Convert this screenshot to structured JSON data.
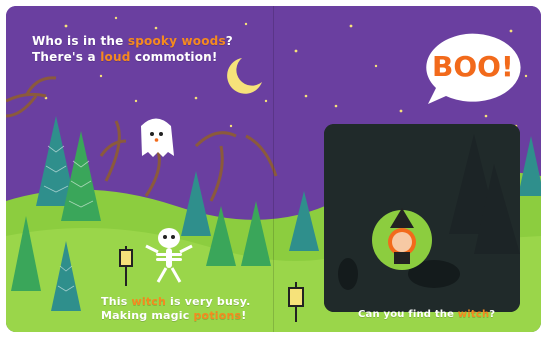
{
  "left_page": {
    "line1_a": "Who is in the ",
    "line1_b": "spooky woods",
    "line1_c": "?",
    "line2_a": "There's a ",
    "line2_b": "loud",
    "line2_c": " commotion!",
    "bottom_line1_a": "This ",
    "bottom_line1_b": "witch",
    "bottom_line1_c": " is very busy.",
    "bottom_line2_a": "Making magic ",
    "bottom_line2_b": "potions",
    "bottom_line2_c": "!"
  },
  "right_page": {
    "boo": "BOO!",
    "question_a": "Can you find the ",
    "question_b": "witch",
    "question_c": "?"
  },
  "colors": {
    "sky": "#6a3fa0",
    "grass": "#8ccd3f",
    "accent": "#f58a1f",
    "moon": "#f6e27a"
  }
}
